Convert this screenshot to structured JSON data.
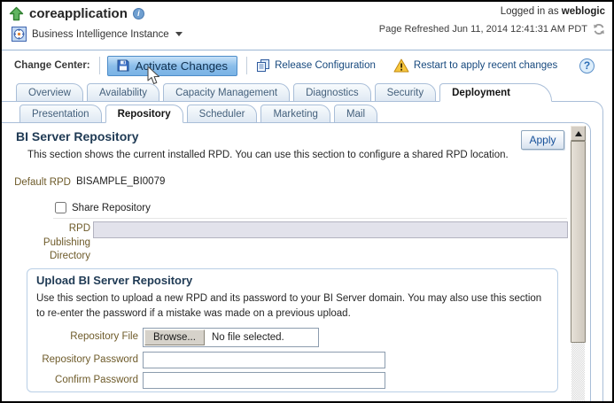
{
  "header": {
    "title": "coreapplication",
    "instance_menu": "Business Intelligence Instance",
    "logged_in_label": "Logged in as",
    "logged_in_user": "weblogic",
    "page_refreshed": "Page Refreshed Jun 11, 2014 12:41:31 AM PDT"
  },
  "change_center": {
    "label": "Change Center:",
    "activate_button": "Activate Changes",
    "release_link": "Release Configuration",
    "restart_notice": "Restart to apply recent changes"
  },
  "tabs_primary": {
    "items": [
      "Overview",
      "Availability",
      "Capacity Management",
      "Diagnostics",
      "Security",
      "Deployment"
    ],
    "active": "Deployment"
  },
  "tabs_secondary": {
    "items": [
      "Presentation",
      "Repository",
      "Scheduler",
      "Marketing",
      "Mail"
    ],
    "active": "Repository"
  },
  "repo": {
    "title": "BI Server Repository",
    "apply_button": "Apply",
    "description": "This section shows the current installed RPD. You can use this section to configure a shared RPD location.",
    "default_rpd_label": "Default RPD",
    "default_rpd_value": "BISAMPLE_BI0079",
    "share_label": "Share Repository",
    "share_checked": false,
    "rpd_dir_label": "RPD Publishing Directory",
    "rpd_dir_value": ""
  },
  "upload": {
    "title": "Upload BI Server Repository",
    "description": "Use this section to upload a new RPD and its password to your BI Server domain. You may also use this section to re-enter the password if a mistake was made on a previous upload.",
    "file_label": "Repository File",
    "browse_button": "Browse...",
    "file_status": "No file selected.",
    "password_label": "Repository Password",
    "password_value": "",
    "confirm_label": "Confirm Password",
    "confirm_value": ""
  },
  "icons": {
    "help_glyph": "?",
    "info_glyph": "i"
  },
  "colors": {
    "accent_button": "#8bbeea",
    "link_blue": "#17497e",
    "heading_navy": "#1f3a54",
    "label_brown": "#6e5b2a",
    "tab_border": "#a9bed8",
    "warning_yellow": "#f6c63d"
  }
}
